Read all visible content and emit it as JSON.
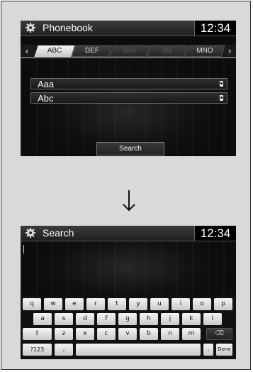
{
  "top_screen": {
    "title": "Phonebook",
    "time": "12:34",
    "tabs": [
      "ABC",
      "DEF",
      "GHI",
      "JKL",
      "MNO"
    ],
    "prev_arrow": "‹",
    "next_arrow": "›",
    "entries": [
      "Aaa",
      "Abc"
    ],
    "search_button": "Search"
  },
  "bottom_screen": {
    "title": "Search",
    "time": "12:34",
    "keyboard": {
      "row1": [
        "q",
        "w",
        "e",
        "r",
        "t",
        "y",
        "u",
        "i",
        "o",
        "p"
      ],
      "row2": [
        "a",
        "s",
        "d",
        "f",
        "g",
        "h",
        "j",
        "k",
        "l"
      ],
      "row3": [
        "z",
        "x",
        "c",
        "v",
        "b",
        "n",
        "m"
      ],
      "shift": "⇧",
      "backspace": "⌫",
      "symbols": "?123",
      "comma": ",",
      "period": ".",
      "done": "Done"
    }
  }
}
